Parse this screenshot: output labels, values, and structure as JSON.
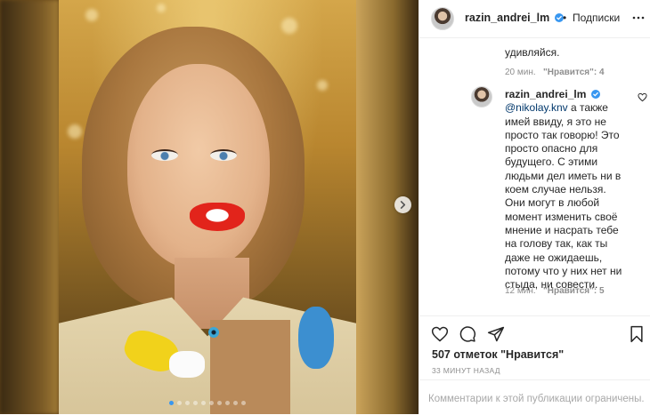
{
  "header": {
    "username": "razin_andrei_lm",
    "separator": "•",
    "follow_label": "Подписки"
  },
  "comments": [
    {
      "text_tail": "удивляйся.",
      "time": "20 мин.",
      "likes_label": "\"Нравится\": 4"
    },
    {
      "username": "razin_andrei_lm",
      "mention": "@nikolay.knv",
      "text": " а также имей ввиду, я это не просто так говорю! Это просто опасно для будущего. С этими людьми дел иметь ни в коем случае нельзя. Они могут в любой момент изменить своё мнение и насрать тебе на голову так, как ты даже не ожидаешь, потому что у них нет ни стыда, ни совести.",
      "time": "12 мин.",
      "likes_label": "\"Нравится\": 5"
    }
  ],
  "post": {
    "likes_text": "507 отметок \"Нравится\"",
    "posted_time": "33 МИНУТ НАЗАД",
    "comments_restricted": "Комментарии к этой публикации ограничены."
  },
  "carousel": {
    "total_slides": 10,
    "active_index": 0
  },
  "colors": {
    "accent": "#3897f0",
    "mention": "#00376b",
    "meta_text": "#8e8e8e",
    "border": "#efefef"
  }
}
